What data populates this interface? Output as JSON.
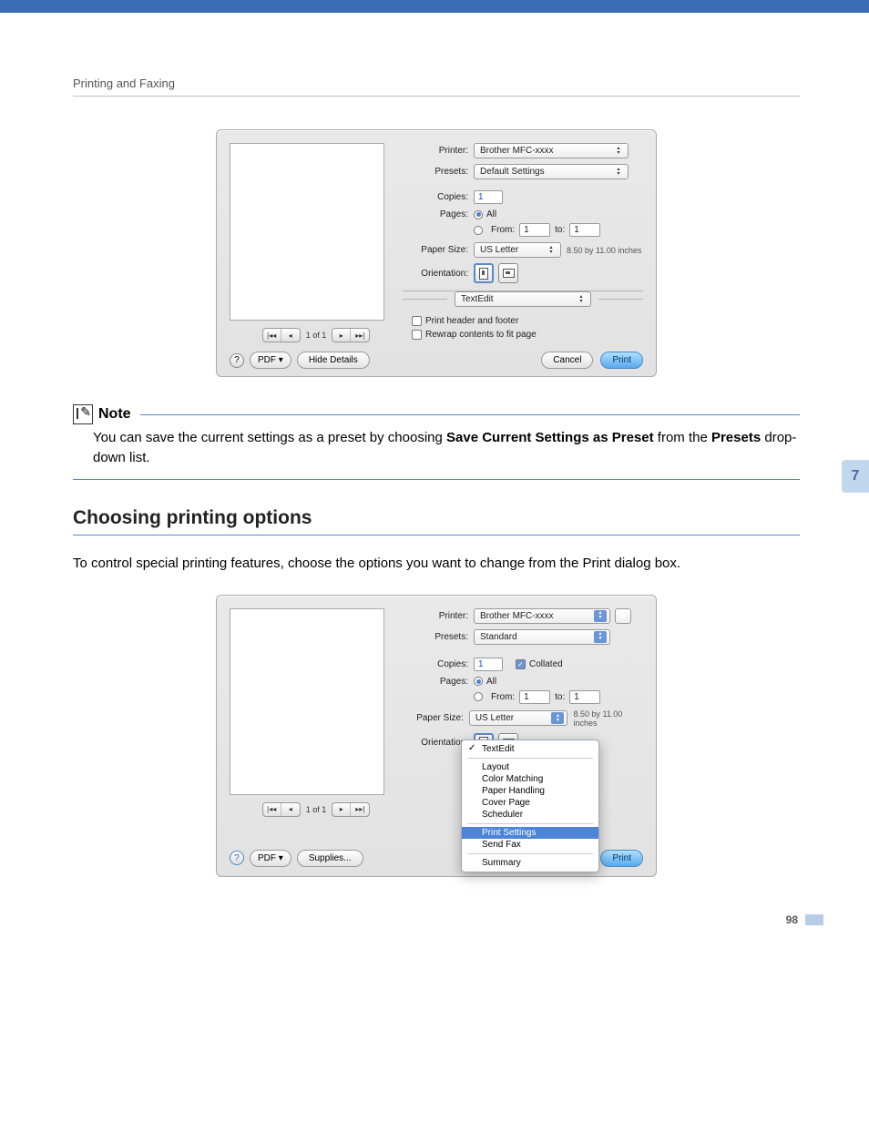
{
  "header": {
    "section": "Printing and Faxing"
  },
  "chapter_tab": "7",
  "page_number": "98",
  "dialog1": {
    "printer": {
      "label": "Printer:",
      "value": "Brother MFC-xxxx"
    },
    "presets": {
      "label": "Presets:",
      "value": "Default Settings"
    },
    "copies": {
      "label": "Copies:",
      "value": "1"
    },
    "pages": {
      "label": "Pages:",
      "all": "All",
      "from_label": "From:",
      "from_value": "1",
      "to_label": "to:",
      "to_value": "1"
    },
    "paper_size": {
      "label": "Paper Size:",
      "value": "US Letter",
      "dimensions": "8.50 by 11.00 inches"
    },
    "orientation_label": "Orientation:",
    "panel_select": "TextEdit",
    "opt1": "Print header and footer",
    "opt2": "Rewrap contents to fit page",
    "pager": "1 of 1",
    "pdf_btn": "PDF ▾",
    "details_btn": "Hide Details",
    "cancel": "Cancel",
    "print": "Print",
    "help": "?"
  },
  "note": {
    "title": "Note",
    "body_a": "You can save the current settings as a preset by choosing ",
    "body_b": "Save Current Settings as Preset",
    "body_c": " from the ",
    "body_d": "Presets",
    "body_e": " drop-down list."
  },
  "section": {
    "heading": "Choosing printing options",
    "body": "To control special printing features, choose the options you want to change from the Print dialog box."
  },
  "dialog2": {
    "printer": {
      "label": "Printer:",
      "value": "Brother MFC-xxxx"
    },
    "presets": {
      "label": "Presets:",
      "value": "Standard"
    },
    "copies": {
      "label": "Copies:",
      "value": "1",
      "collated": "Collated"
    },
    "pages": {
      "label": "Pages:",
      "all": "All",
      "from_label": "From:",
      "from_value": "1",
      "to_label": "to:",
      "to_value": "1"
    },
    "paper_size": {
      "label": "Paper Size:",
      "value": "US Letter",
      "dimensions": "8.50 by 11.00 inches"
    },
    "orientation_label": "Orientation:",
    "pager": "1 of 1",
    "pdf_btn": "PDF ▾",
    "supplies_btn": "Supplies...",
    "print": "Print",
    "help": "?",
    "menu": {
      "textedit": "TextEdit",
      "layout": "Layout",
      "color": "Color Matching",
      "paper": "Paper Handling",
      "cover": "Cover Page",
      "scheduler": "Scheduler",
      "print_settings": "Print Settings",
      "send_fax": "Send Fax",
      "summary": "Summary"
    }
  }
}
